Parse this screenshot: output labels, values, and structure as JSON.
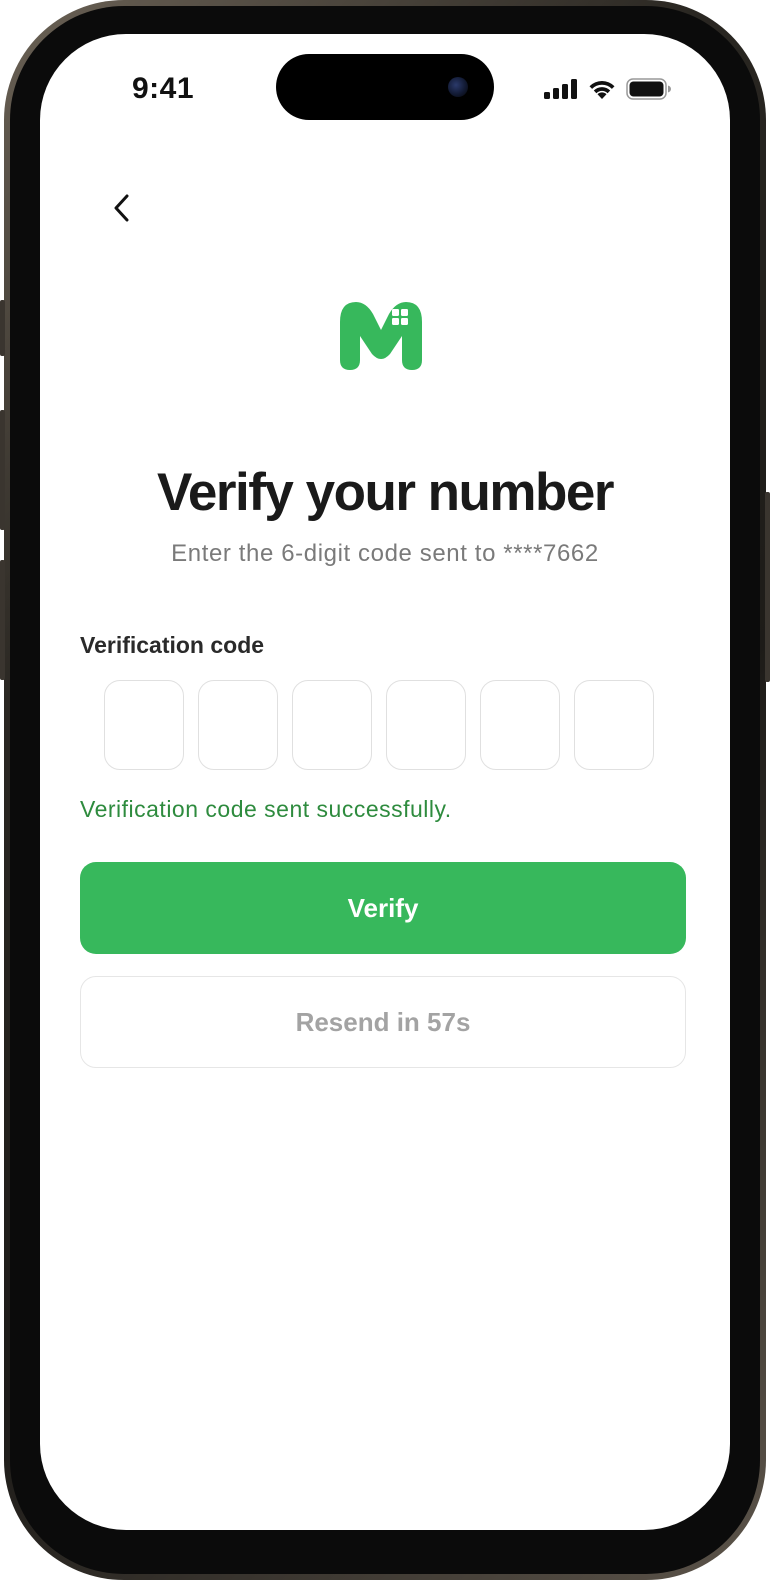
{
  "status_bar": {
    "time": "9:41",
    "icons": [
      "cellular-signal-icon",
      "wifi-icon",
      "battery-icon"
    ]
  },
  "nav": {
    "back_icon": "chevron-left-icon"
  },
  "brand": {
    "logo_icon": "m-house-logo",
    "color": "#37b85c"
  },
  "header": {
    "title": "Verify your number",
    "subtitle": "Enter the 6-digit code sent to ****7662"
  },
  "form": {
    "label": "Verification code",
    "code_digits": [
      "",
      "",
      "",
      "",
      "",
      ""
    ],
    "success_message": "Verification code sent successfully.",
    "success_color": "#2e8b3e"
  },
  "actions": {
    "verify_label": "Verify",
    "resend_label": "Resend in 57s"
  }
}
